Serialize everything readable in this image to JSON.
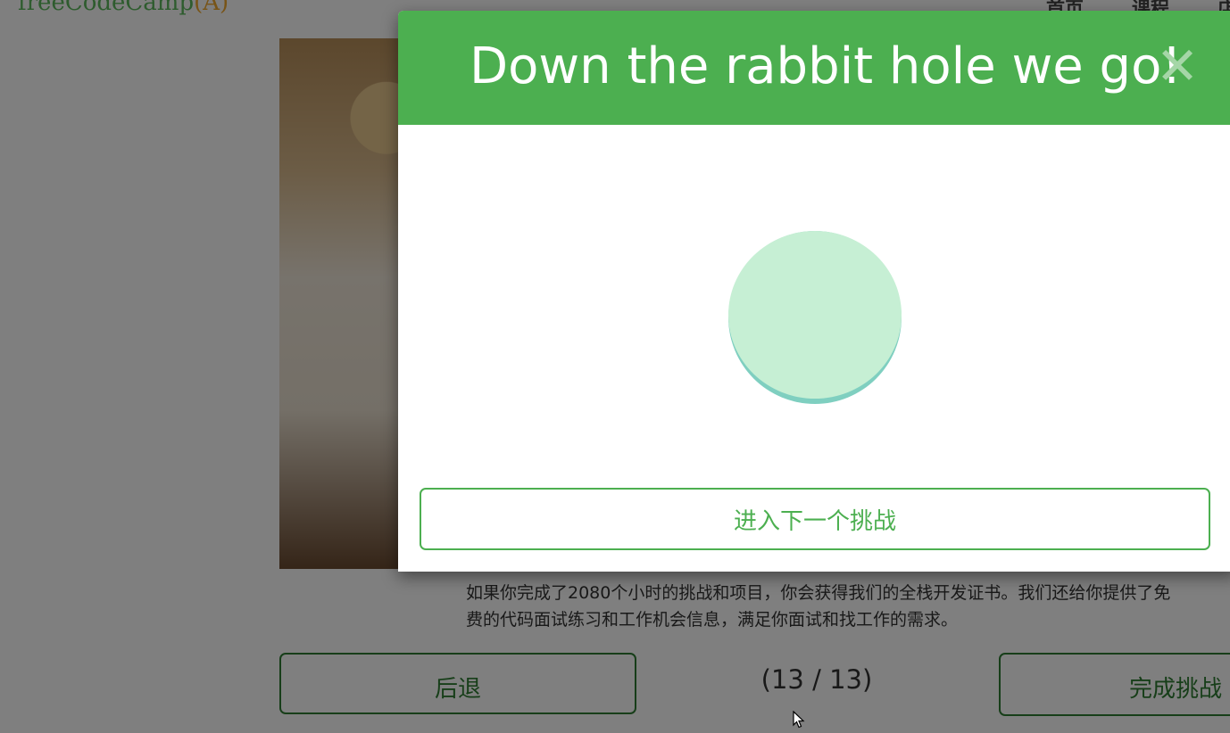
{
  "navbar": {
    "logo_text": "freeCodeCamp",
    "logo_suffix": "(A)",
    "links": [
      "首页",
      "课程",
      "店"
    ]
  },
  "page": {
    "description": "如果你完成了2080个小时的挑战和项目，你会获得我们的全栈开发证书。我们还给你提供了免费的代码面试练习和工作机会信息，满足你面试和找工作的需求。",
    "back_label": "后退",
    "counter": "(13 / 13)",
    "complete_label": "完成挑战"
  },
  "modal": {
    "title": "Down the rabbit hole we go!",
    "close_glyph": "✕",
    "next_label": "进入下一个挑战"
  },
  "colors": {
    "accent": "#4caf50",
    "dark_green": "#2e7d32",
    "ball": "#c6efd4",
    "ball_shadow": "#7fcfc0"
  },
  "icons": {
    "close": "close-icon",
    "cursor": "mouse-cursor-icon"
  }
}
